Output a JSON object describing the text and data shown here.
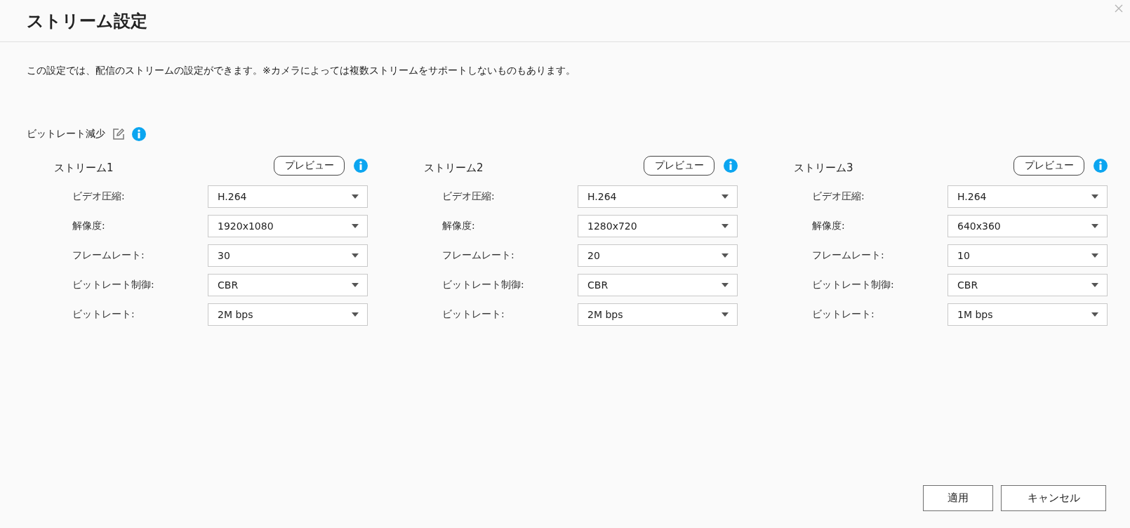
{
  "window": {
    "title": "ストリーム設定"
  },
  "description": "この設定では、配信のストリームの設定ができます。※カメラによっては複数ストリームをサポートしないものもあります。",
  "bitrate_reduction": {
    "label": "ビットレート減少"
  },
  "streams": [
    {
      "title": "ストリーム1",
      "preview_button": "プレビュー",
      "fields": [
        {
          "label": "ビデオ圧縮:",
          "value": "H.264"
        },
        {
          "label": "解像度:",
          "value": "1920x1080"
        },
        {
          "label": "フレームレート:",
          "value": "30"
        },
        {
          "label": "ビットレート制御:",
          "value": "CBR"
        },
        {
          "label": "ビットレート:",
          "value": "2M bps"
        }
      ]
    },
    {
      "title": "ストリーム2",
      "preview_button": "プレビュー",
      "fields": [
        {
          "label": "ビデオ圧縮:",
          "value": "H.264"
        },
        {
          "label": "解像度:",
          "value": "1280x720"
        },
        {
          "label": "フレームレート:",
          "value": "20"
        },
        {
          "label": "ビットレート制御:",
          "value": "CBR"
        },
        {
          "label": "ビットレート:",
          "value": "2M bps"
        }
      ]
    },
    {
      "title": "ストリーム3",
      "preview_button": "プレビュー",
      "fields": [
        {
          "label": "ビデオ圧縮:",
          "value": "H.264"
        },
        {
          "label": "解像度:",
          "value": "640x360"
        },
        {
          "label": "フレームレート:",
          "value": "10"
        },
        {
          "label": "ビットレート制御:",
          "value": "CBR"
        },
        {
          "label": "ビットレート:",
          "value": "1M bps"
        }
      ]
    }
  ],
  "buttons": [
    "適用",
    "キャンセル"
  ]
}
